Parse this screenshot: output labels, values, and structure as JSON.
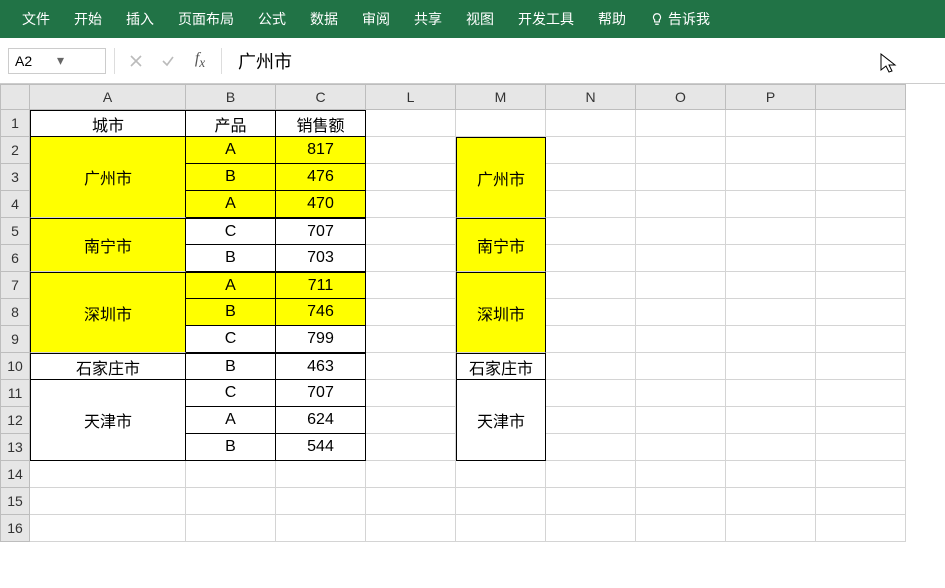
{
  "ribbon": {
    "tabs": [
      "文件",
      "开始",
      "插入",
      "页面布局",
      "公式",
      "数据",
      "审阅",
      "共享",
      "视图",
      "开发工具",
      "帮助"
    ],
    "tell": "告诉我"
  },
  "formula_bar": {
    "name_box": "A2",
    "value": "广州市"
  },
  "columns": [
    "A",
    "B",
    "C",
    "L",
    "M",
    "N",
    "O",
    "P",
    ""
  ],
  "rows": [
    "1",
    "2",
    "3",
    "4",
    "5",
    "6",
    "7",
    "8",
    "9",
    "10",
    "11",
    "12",
    "13",
    "14",
    "15",
    "16"
  ],
  "headers": {
    "city": "城市",
    "product": "产品",
    "sales": "销售额"
  },
  "cities": {
    "c1": "广州市",
    "c2": "南宁市",
    "c3": "深圳市",
    "c4": "石家庄市",
    "c5": "天津市"
  },
  "data": {
    "r2p": "A",
    "r2s": "817",
    "r3p": "B",
    "r3s": "476",
    "r4p": "A",
    "r4s": "470",
    "r5p": "C",
    "r5s": "707",
    "r6p": "B",
    "r6s": "703",
    "r7p": "A",
    "r7s": "711",
    "r8p": "B",
    "r8s": "746",
    "r9p": "C",
    "r9s": "799",
    "r10p": "B",
    "r10s": "463",
    "r11p": "C",
    "r11s": "707",
    "r12p": "A",
    "r12s": "624",
    "r13p": "B",
    "r13s": "544"
  }
}
